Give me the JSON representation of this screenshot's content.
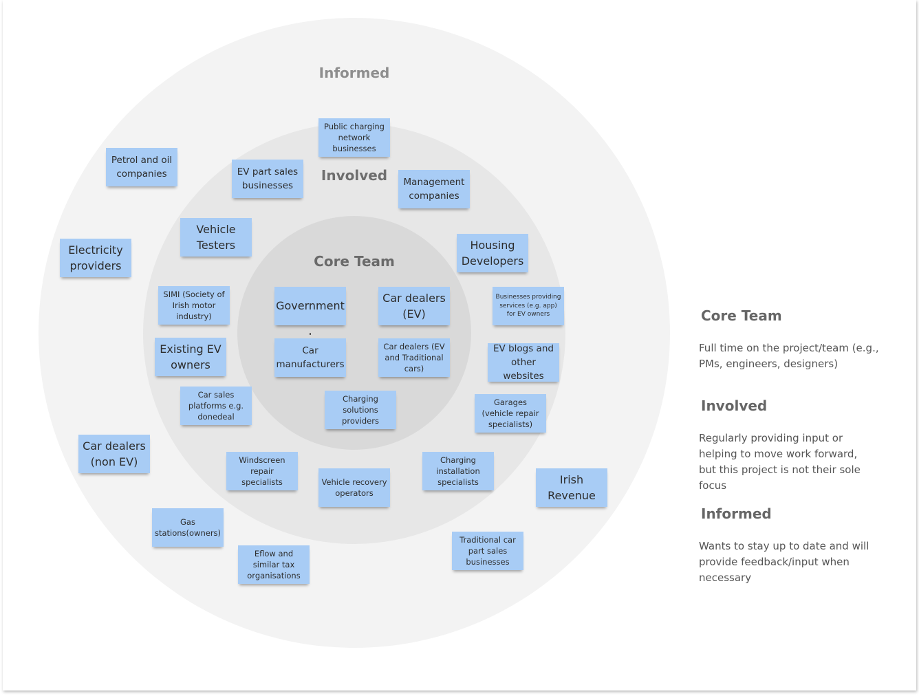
{
  "rings": {
    "informed": "Informed",
    "involved": "Involved",
    "core": "Core Team"
  },
  "stickies": {
    "core": [
      "Government",
      "Car dealers (EV)",
      "Car manufacturers",
      "Car dealers (EV and Traditional cars)",
      "Charging solutions providers"
    ],
    "involved": [
      "Public charging network businesses",
      "EV part sales businesses",
      "Management companies",
      "Vehicle Testers",
      "Housing Developers",
      "SIMI (Society of Irish motor industry)",
      "Businesses providing services (e.g. app) for EV owners",
      "Existing EV owners",
      "EV blogs and other websites",
      "Car sales platforms e.g. donedeal",
      "Garages (vehicle repair specialists)",
      "Windscreen repair specialists",
      "Vehicle recovery operators",
      "Charging installation specialists"
    ],
    "informed": [
      "Petrol and oil companies",
      "Electricity providers",
      "Car dealers (non EV)",
      "Irish Revenue",
      "Gas stations(owners)",
      "Eflow and similar tax organisations",
      "Traditional car part sales businesses"
    ]
  },
  "legend": [
    {
      "title": "Core Team",
      "description": "Full time on the project/team (e.g., PMs, engineers, designers)"
    },
    {
      "title": "Involved",
      "description": "Regularly providing input or helping to move work forward, but this project is not their sole focus"
    },
    {
      "title": "Informed",
      "description": "Wants to stay up to date and will provide feedback/input when necessary"
    }
  ],
  "colors": {
    "sticky": "#a8ccf5",
    "ring_informed": "#f3f3f3",
    "ring_involved": "#e7e7e7",
    "ring_core": "#d9d9d9"
  }
}
